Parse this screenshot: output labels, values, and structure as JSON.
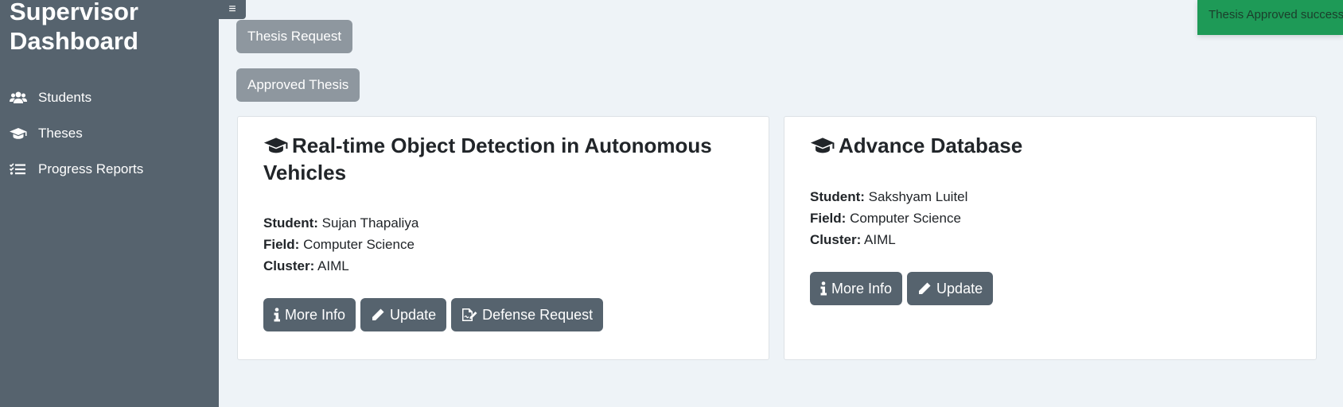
{
  "sidebar": {
    "title_line1": "Supervisor",
    "title_line2": "Dashboard",
    "items": [
      {
        "label": "Students",
        "icon": "users-icon"
      },
      {
        "label": "Theses",
        "icon": "graduation-cap-icon"
      },
      {
        "label": "Progress Reports",
        "icon": "list-check-icon"
      }
    ],
    "toggle_icon": "≡"
  },
  "top_buttons": {
    "thesis_request": "Thesis Request",
    "approved_thesis": "Approved Thesis"
  },
  "cards": [
    {
      "title": "Real-time Object Detection in Autonomous Vehicles",
      "student_label": "Student:",
      "student": "Sujan Thapaliya",
      "field_label": "Field:",
      "field": "Computer Science",
      "cluster_label": "Cluster:",
      "cluster": "AIML",
      "more_info": "More Info",
      "update": "Update",
      "defense_request": "Defense Request"
    },
    {
      "title": "Advance Database",
      "student_label": "Student:",
      "student": "Sakshyam Luitel",
      "field_label": "Field:",
      "field": "Computer Science",
      "cluster_label": "Cluster:",
      "cluster": "AIML",
      "more_info": "More Info",
      "update": "Update"
    }
  ],
  "toast": {
    "message": "Thesis Approved success"
  },
  "colors": {
    "sidebar": "#56636e",
    "background": "#eef3f7",
    "secondary_button": "#8e979f",
    "success": "#1e9a57"
  }
}
